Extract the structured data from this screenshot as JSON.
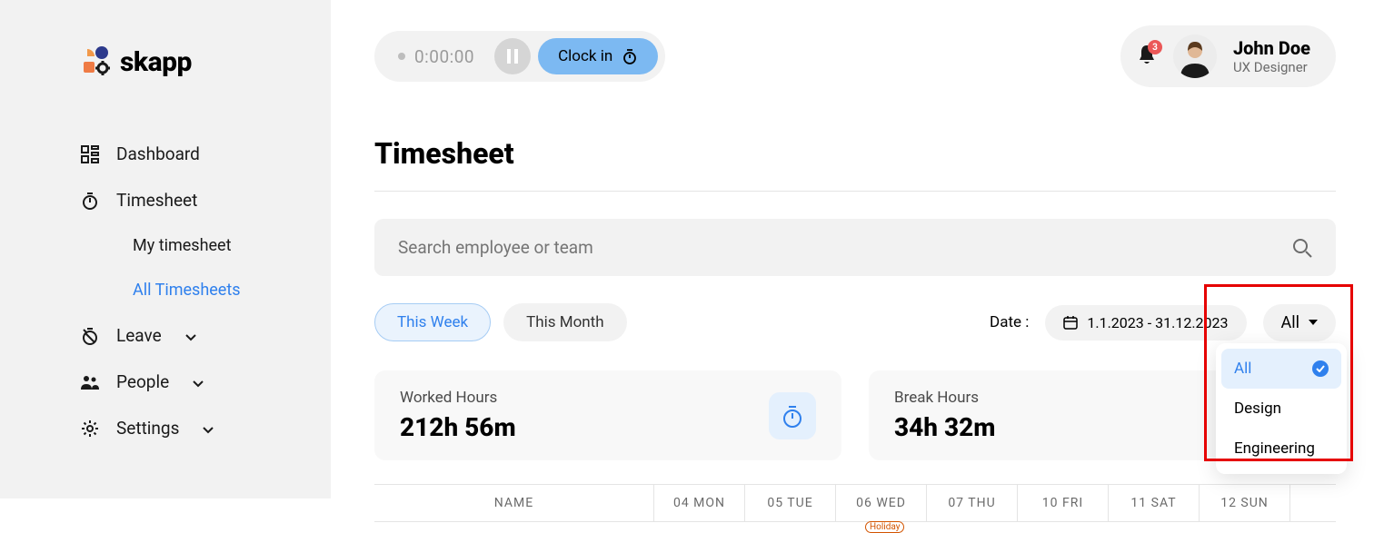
{
  "brand": "skapp",
  "sidebar": {
    "items": [
      {
        "label": "Dashboard"
      },
      {
        "label": "Timesheet"
      },
      {
        "label": "My timesheet"
      },
      {
        "label": "All Timesheets"
      },
      {
        "label": "Leave"
      },
      {
        "label": "People"
      },
      {
        "label": "Settings"
      }
    ]
  },
  "timer": {
    "time": "0:00:00",
    "clock_in_label": "Clock in"
  },
  "notifications": {
    "count": "3"
  },
  "user": {
    "name": "John Doe",
    "role": "UX Designer"
  },
  "page": {
    "title": "Timesheet"
  },
  "search": {
    "placeholder": "Search employee or team"
  },
  "filters": {
    "this_week": "This Week",
    "this_month": "This Month",
    "date_label": "Date :",
    "date_range": "1.1.2023 - 31.12.2023",
    "team_selected": "All"
  },
  "dropdown": {
    "options": [
      {
        "label": "All"
      },
      {
        "label": "Design"
      },
      {
        "label": "Engineering"
      }
    ]
  },
  "stats": {
    "worked_label": "Worked Hours",
    "worked_value": "212h 56m",
    "break_label": "Break Hours",
    "break_value": "34h 32m"
  },
  "table": {
    "name_header": "NAME",
    "days": [
      {
        "label": "04 MON"
      },
      {
        "label": "05 TUE"
      },
      {
        "label": "06 WED"
      },
      {
        "label": "07 THU"
      },
      {
        "label": "10 FRI"
      },
      {
        "label": "11 SAT"
      },
      {
        "label": "12 SUN"
      }
    ],
    "holiday_tag": "Holiday"
  }
}
